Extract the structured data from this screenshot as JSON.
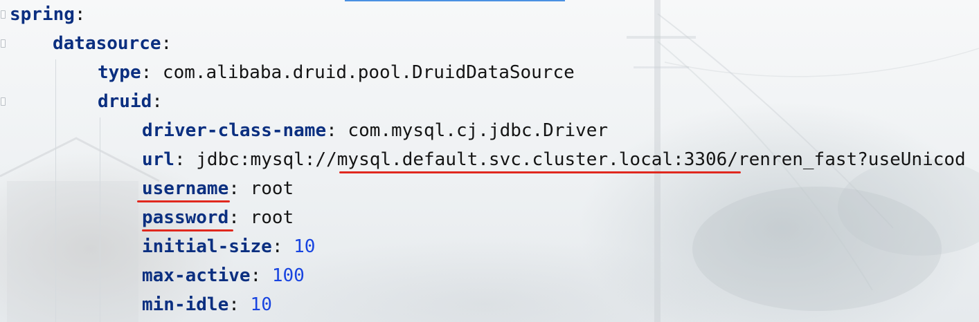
{
  "editor": {
    "accent_color": "#4a90e2",
    "key_color": "#0b2f80",
    "number_color": "#1844e0",
    "underline_color": "#e0281e",
    "lines": [
      {
        "key": "spring",
        "colon": ":",
        "value": ""
      },
      {
        "key": "datasource",
        "colon": ":",
        "value": ""
      },
      {
        "key": "type",
        "colon": ":",
        "value": " com.alibaba.druid.pool.DruidDataSource"
      },
      {
        "key": "druid",
        "colon": ":",
        "value": ""
      },
      {
        "key": "driver-class-name",
        "colon": ":",
        "value": " com.mysql.cj.jdbc.Driver"
      },
      {
        "key": "url",
        "colon": ":",
        "value_prefix": " jdbc:mysql://",
        "value_highlight": "mysql.default.svc.cluster.local:3306",
        "value_suffix": "/renren_fast?useUnicod"
      },
      {
        "key": "username",
        "colon": ":",
        "value": " root"
      },
      {
        "key": "password",
        "colon": ":",
        "value": " root"
      },
      {
        "key": "initial-size",
        "colon": ":",
        "value": " 10"
      },
      {
        "key": "max-active",
        "colon": ":",
        "value": " 100"
      },
      {
        "key": "min-idle",
        "colon": ":",
        "value": " 10"
      }
    ]
  }
}
